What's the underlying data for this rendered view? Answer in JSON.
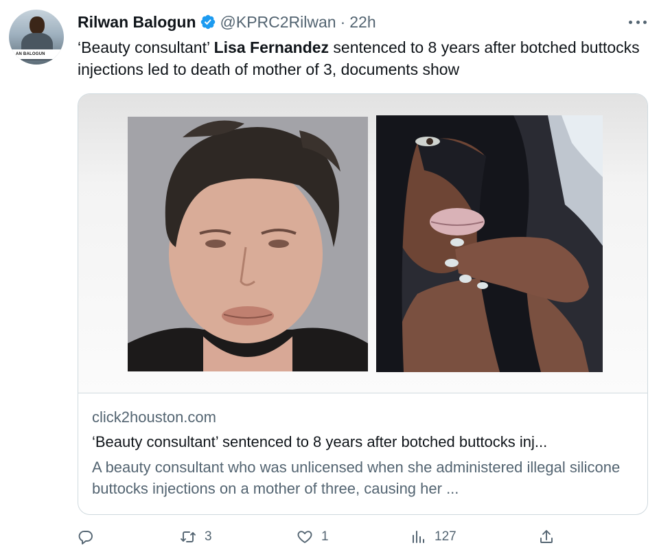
{
  "author": {
    "name": "Rilwan Balogun",
    "handle": "@KPRC2Rilwan",
    "separator": "·",
    "time": "22h",
    "avatar_caption": "AN BALOGUN",
    "verified": true
  },
  "tweet": {
    "text_before": "‘Beauty consultant’ ",
    "text_bold": "Lisa Fernandez",
    "text_after": " sentenced to 8 years after botched buttocks injections led to death of mother of 3, documents show"
  },
  "card": {
    "domain": "click2houston.com",
    "title": "‘Beauty consultant’ sentenced to 8 years after botched buttocks inj...",
    "description": "A beauty consultant who was unlicensed when she administered illegal silicone buttocks injections on a mother of three, causing her ..."
  },
  "actions": {
    "replies": "",
    "retweets": "3",
    "likes": "1",
    "views": "127"
  },
  "icons": {
    "reply": "speech-bubble",
    "retweet": "two-arrows-loop",
    "like": "heart-outline",
    "views": "bar-chart",
    "share": "upload-arrow",
    "more": "three-dots",
    "verified": "blue-check-badge"
  },
  "colors": {
    "text_primary": "#0f1419",
    "text_secondary": "#536471",
    "verified_blue": "#1d9bf0",
    "border": "#cfd9de"
  }
}
